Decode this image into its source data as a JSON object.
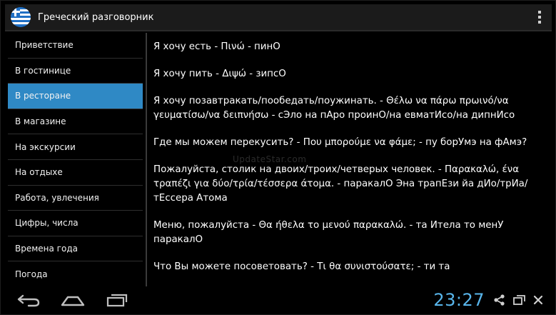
{
  "app": {
    "title": "Греческий разговорник",
    "flag_icon": "greek-flag-icon",
    "menu_icon": "overflow-menu-icon"
  },
  "sidebar": {
    "items": [
      {
        "label": "Приветствие",
        "selected": false
      },
      {
        "label": "В гостинице",
        "selected": false
      },
      {
        "label": "В ресторане",
        "selected": true
      },
      {
        "label": "В магазине",
        "selected": false
      },
      {
        "label": "На экскурсии",
        "selected": false
      },
      {
        "label": "На отдыхе",
        "selected": false
      },
      {
        "label": "Работа, увлечения",
        "selected": false
      },
      {
        "label": "Цифры, числа",
        "selected": false
      },
      {
        "label": "Времена года",
        "selected": false
      },
      {
        "label": "Погода",
        "selected": false
      }
    ]
  },
  "content": {
    "phrases": [
      "Я хочу есть - Πινώ - пинО",
      "Я хочу пить - Διψώ - зипсО",
      "Я хочу позавтракать/пообедать/поужинать. - Θέλω να πάρω πρωινό/να γευματίσω/να δειπνήσω - сЭло на пАро проинО/на евматИсо/на дипнИсо",
      "Где мы можем перекусить? - Που μπορούμε να φάμε; - пу борУмэ на фАмэ?",
      "Пожалуйста, столик на двоих/троих/четверых человек. - Παρακαλώ, ένα τραπέζι για δύο/τρία/τέσσερα άτομα. - паракалО Эна трапЕзи йа дИо/трИа/тЕссера Атома",
      "Меню, пожалуйста - Θα ήθελα το μενού παρακαλώ. - та Ителa то менУ паракалО",
      "Что Вы можете посоветовать? - Τι θα συνιστούσατε; - ти тa"
    ]
  },
  "watermark": "UpdateStar.com",
  "system_bar": {
    "clock": "23:27",
    "back_icon": "back-icon",
    "home_icon": "home-icon",
    "recents_icon": "recents-icon",
    "share_icon": "share-icon",
    "window_icon": "window-icon",
    "close_icon": "close-icon",
    "clock_color": "#59b6ec"
  },
  "colors": {
    "accent": "#2f89c5",
    "action_bar": "#1b1b1b",
    "background": "#000000"
  }
}
